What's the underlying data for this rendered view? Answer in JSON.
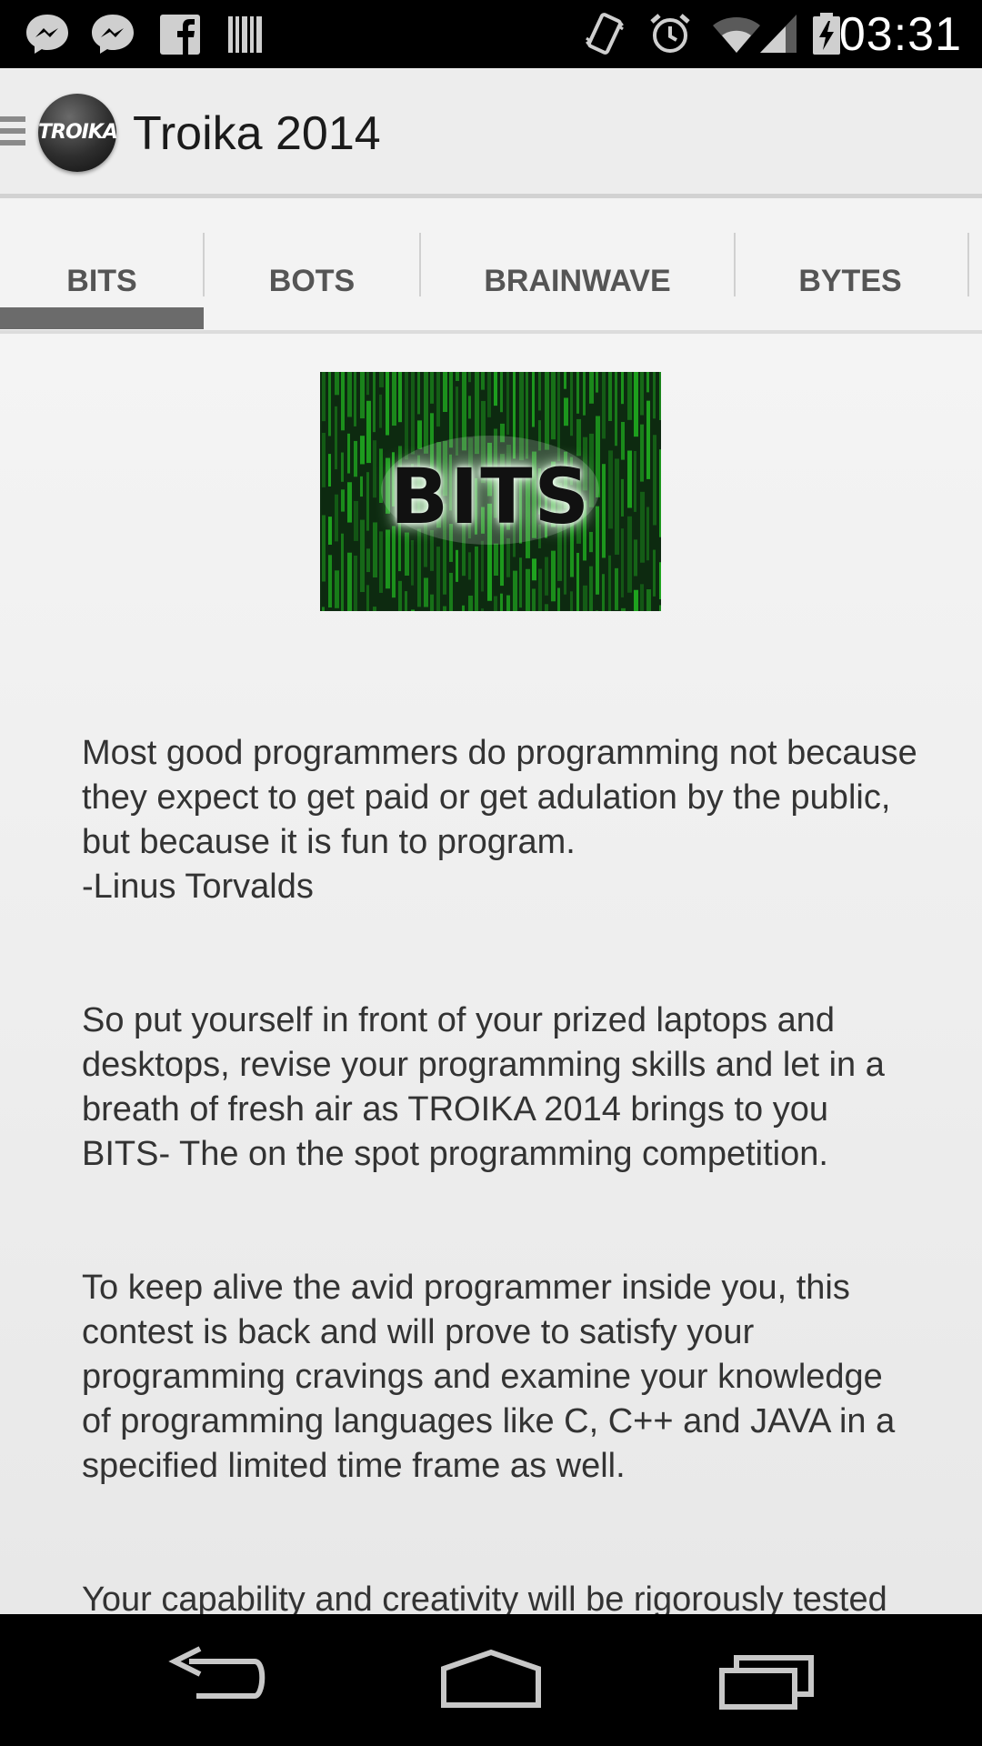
{
  "status_bar": {
    "time": "03:31",
    "icons": [
      "messenger-icon",
      "messenger-icon",
      "facebook-icon",
      "barcode-icon",
      "vibrate-icon",
      "alarm-icon",
      "wifi-icon",
      "signal-icon",
      "battery-charging-icon"
    ]
  },
  "action_bar": {
    "title": "Troika 2014",
    "logo_text": "TROIKA"
  },
  "tabs": [
    {
      "label": "BITS",
      "selected": true
    },
    {
      "label": "BOTS",
      "selected": false
    },
    {
      "label": "BRAINWAVE",
      "selected": false
    },
    {
      "label": "BYTES",
      "selected": false
    }
  ],
  "content": {
    "banner_text": "BITS",
    "paragraphs": [
      "Most good programmers do programming not because they expect to get paid or get adulation by the public, but because it is fun to program.\n  -Linus Torvalds",
      "So put yourself in front of your prized laptops and desktops, revise your programming skills and let in a breath of fresh air as TROIKA 2014 brings to you BITS- The on the spot programming competition.",
      "To keep alive the avid programmer inside you, this contest is back and will prove to satisfy your programming cravings and examine your knowledge of programming languages like C, C++ and JAVA in a specified limited time frame as well.",
      "Your capability and creativity will be rigorously tested not only on a single level but on a multitude of levels. This contest will involve a"
    ]
  },
  "nav_bar": {
    "buttons": [
      "back-icon",
      "home-icon",
      "recents-icon"
    ]
  },
  "colors": {
    "status_bar": "#000000",
    "action_bar": "#ededed",
    "tab_indicator": "#6b6b6b",
    "banner_green": "#1fa51f"
  }
}
